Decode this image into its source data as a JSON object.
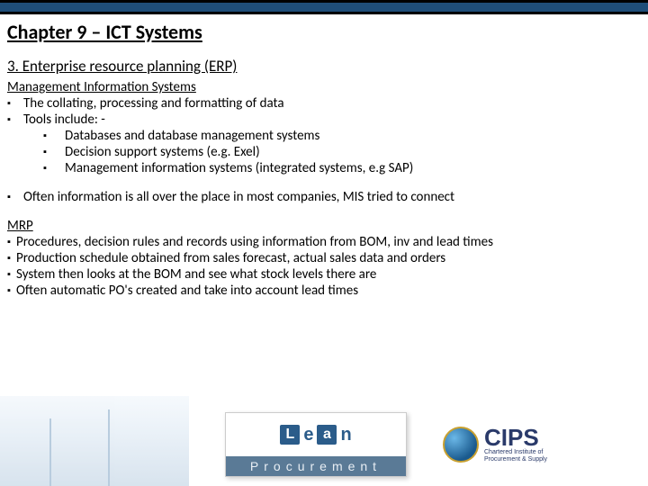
{
  "chapter_title": "Chapter 9 – ICT Systems",
  "section_title": "3. Enterprise resource planning (ERP)",
  "mis": {
    "heading": "Management Information Systems",
    "b1": "The collating, processing and formatting of data",
    "b2": "Tools include: -",
    "sub1": "Databases and database management systems",
    "sub2": "Decision support systems (e.g. Exel)",
    "sub3": "Management information systems (integrated systems, e.g SAP)",
    "b3": "Often information is all over the place in most companies, MIS tried to connect"
  },
  "mrp": {
    "heading": "MRP",
    "b1": "Procedures, decision rules and records using information from BOM, inv and lead times",
    "b2": "Production schedule obtained from sales forecast, actual sales data and orders",
    "b3": "System then looks at the BOM and see what stock levels there are",
    "b4": "Often automatic PO's created and take into account lead times"
  },
  "logos": {
    "lean_word": "Lean",
    "lean_sub": "Procurement",
    "cips": "CIPS",
    "cips_sub1": "Chartered Institute of",
    "cips_sub2": "Procurement & Supply"
  }
}
